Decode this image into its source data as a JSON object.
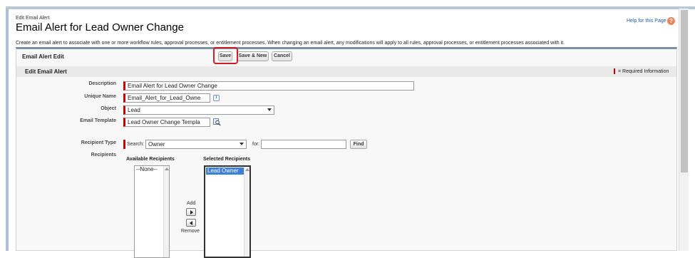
{
  "page": {
    "breadcrumb": "Edit Email Alert",
    "title": "Email Alert for Lead Owner Change",
    "help_link": "Help for this Page",
    "help_icon": "?",
    "description": "Create an email alert to associate with one or more workflow rules, approval processes, or entitlement processes. When changing an email alert, any modifications will apply to all rules, approval processes, or entitlement processes associated with it."
  },
  "panel": {
    "title": "Email Alert Edit",
    "buttons": {
      "save": "Save",
      "save_new": "Save & New",
      "cancel": "Cancel"
    },
    "section_title": "Edit Email Alert",
    "required_legend": "= Required Information"
  },
  "form": {
    "description_label": "Description",
    "description_value": "Email Alert for Lead Owner Change",
    "unique_name_label": "Unique Name",
    "unique_name_value": "Email_Alert_for_Lead_Owne",
    "object_label": "Object",
    "object_value": "Lead",
    "email_template_label": "Email Template",
    "email_template_value": "Lead Owner Change Templa",
    "recipient_type_label": "Recipient Type",
    "search_label": "Search:",
    "search_value": "Owner",
    "for_label": "for:",
    "for_value": "",
    "find_button": "Find",
    "recipients_label": "Recipients"
  },
  "recipients": {
    "available_heading": "Available Recipients",
    "available_items": [
      "--None--"
    ],
    "selected_heading": "Selected Recipients",
    "selected_items": [
      "Lead Owner"
    ],
    "add_label": "Add",
    "remove_label": "Remove"
  },
  "colors": {
    "required_marker": "#cc0000",
    "highlight_box": "#cf1f24",
    "selected_option": "#3b7fd6",
    "help_icon": "#e8865a"
  },
  "icons": {
    "info": "info-icon",
    "lookup": "lookup-icon",
    "help": "help-icon"
  }
}
